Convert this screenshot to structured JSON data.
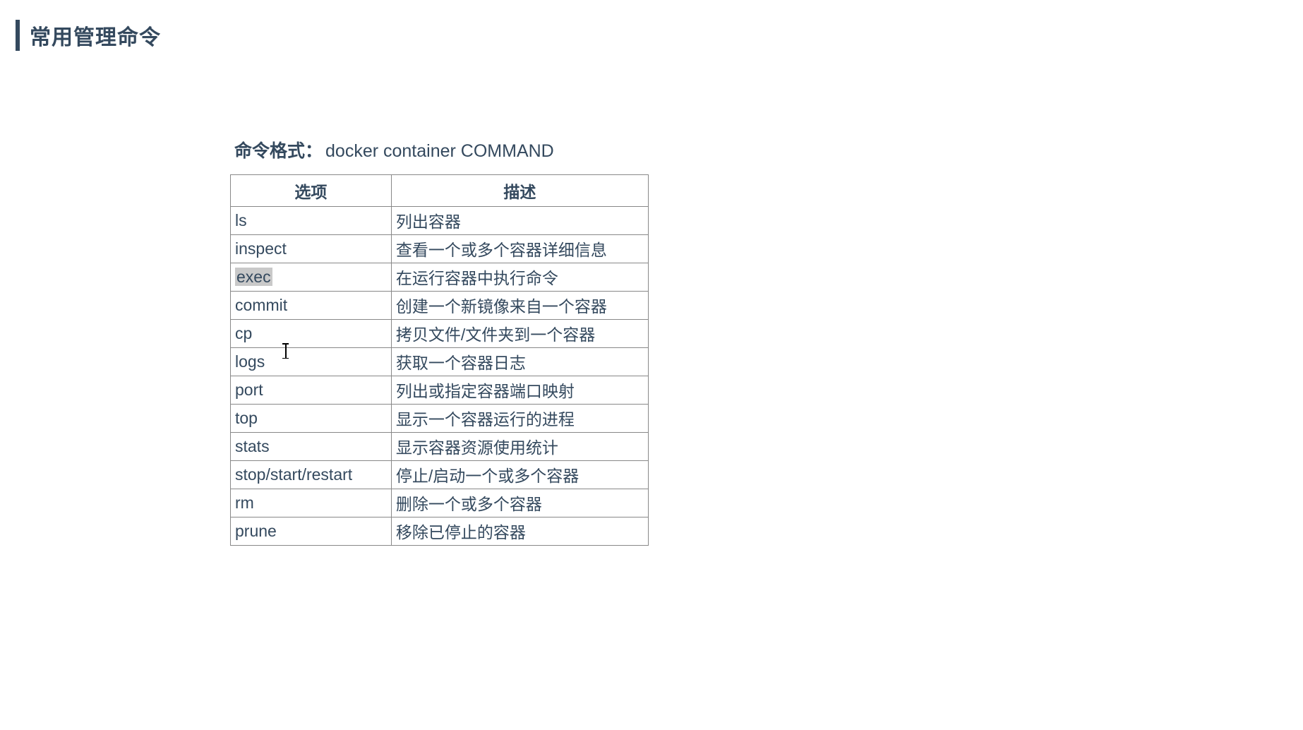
{
  "title": "常用管理命令",
  "format": {
    "label": "命令格式：",
    "value": "docker container COMMAND"
  },
  "table": {
    "headers": {
      "option": "选项",
      "description": "描述"
    },
    "rows": [
      {
        "option": "ls",
        "description": "列出容器",
        "highlight": false
      },
      {
        "option": "inspect",
        "description": "查看一个或多个容器详细信息",
        "highlight": false
      },
      {
        "option": "exec",
        "description": "在运行容器中执行命令",
        "highlight": true
      },
      {
        "option": "commit",
        "description": "创建一个新镜像来自一个容器",
        "highlight": false
      },
      {
        "option": "cp",
        "description": "拷贝文件/文件夹到一个容器",
        "highlight": false
      },
      {
        "option": "logs",
        "description": "获取一个容器日志",
        "highlight": false
      },
      {
        "option": "port",
        "description": "列出或指定容器端口映射",
        "highlight": false
      },
      {
        "option": "top",
        "description": "显示一个容器运行的进程",
        "highlight": false
      },
      {
        "option": "stats",
        "description": "显示容器资源使用统计",
        "highlight": false
      },
      {
        "option": "stop/start/restart",
        "description": "停止/启动一个或多个容器",
        "highlight": false
      },
      {
        "option": "rm",
        "description": "删除一个或多个容器",
        "highlight": false
      },
      {
        "option": "prune",
        "description": "移除已停止的容器",
        "highlight": false
      }
    ]
  }
}
